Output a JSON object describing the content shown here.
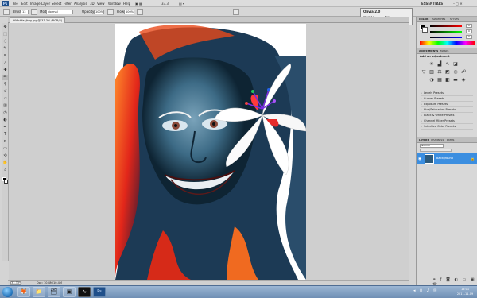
{
  "app": {
    "logo": "Ps"
  },
  "menu": {
    "items": [
      "File",
      "Edit",
      "Image",
      "Layer",
      "Select",
      "Filter",
      "Analysis",
      "3D",
      "View",
      "Window",
      "Help"
    ],
    "zoom": "33.3",
    "workspace": "ESSENTIALS",
    "cs_live": "CS Live"
  },
  "options": {
    "brush_label": "Brush:",
    "brush_size": "13",
    "mode_label": "Mode:",
    "mode_value": "Normal",
    "opacity_label": "Opacity:",
    "opacity_value": "100%",
    "flow_label": "Flow:",
    "flow_value": "100%"
  },
  "document": {
    "tab_label": "bfbfcbfaajkug.jpg @ 33.3% (RGB/8)"
  },
  "status": {
    "zoom": "33.33%",
    "doc": "Doc: 10.4M/10.4M"
  },
  "navigator": {
    "title": "Olivia 2.0",
    "line1": "Olivia 2.0",
    "line2": "Help",
    "line3": "Settings",
    "opt": "Brw"
  },
  "panels": {
    "color_tabs": [
      "COLOR",
      "SWATCHES",
      "STYLES"
    ],
    "rgb_values": [
      "0",
      "0",
      "0"
    ],
    "adjust_tabs": [
      "ADJUSTMENTS",
      "MASKS"
    ],
    "adjust_title": "Add an adjustment",
    "presets": [
      "Levels Presets",
      "Curves Presets",
      "Exposure Presets",
      "Hue/Saturation Presets",
      "Black & White Presets",
      "Channel Mixer Presets",
      "Selective Color Presets"
    ],
    "layer_tabs": [
      "LAYERS",
      "CHANNELS",
      "PATHS"
    ],
    "blend_mode": "Normal",
    "layer_name": "Background"
  },
  "clock": {
    "time": "16:01",
    "date": "2011-11-09"
  },
  "colors": {
    "accent": "#3b8ee0",
    "panel": "#d8d8d8",
    "taskbar": "#7f9dc2"
  }
}
